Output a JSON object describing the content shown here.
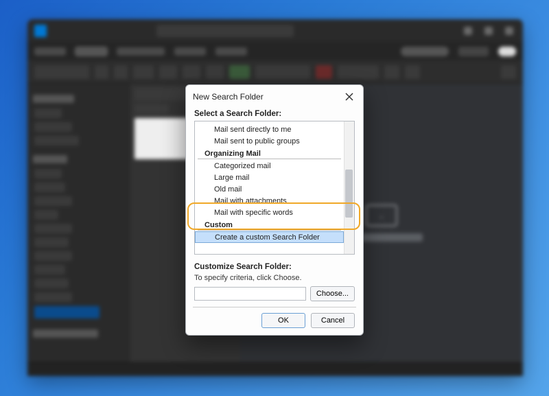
{
  "dialog": {
    "title": "New Search Folder",
    "select_label": "Select a Search Folder:",
    "groups": {
      "reading": {
        "items_visible": [
          "Mail sent directly to me",
          "Mail sent to public groups"
        ]
      },
      "organizing": {
        "header": "Organizing Mail",
        "items": [
          "Categorized mail",
          "Large mail",
          "Old mail",
          "Mail with attachments",
          "Mail with specific words"
        ]
      },
      "custom": {
        "header": "Custom",
        "items": [
          "Create a custom Search Folder"
        ],
        "selected_index": 0
      }
    },
    "customize_label": "Customize Search Folder:",
    "hint": "To specify criteria, click Choose.",
    "choose_btn": "Choose...",
    "ok": "OK",
    "cancel": "Cancel"
  },
  "background": {
    "reader_placeholder": "Select an item to read",
    "sidebar_selected": "Search Folders"
  }
}
